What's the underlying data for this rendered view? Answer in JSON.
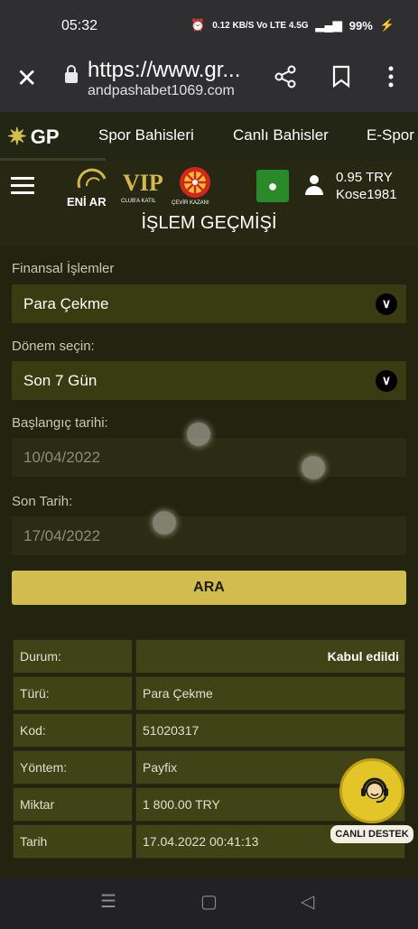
{
  "status_bar": {
    "time": "05:32",
    "indicators": "0.12 KB/S  Vo LTE  4.5G",
    "battery": "99%"
  },
  "url_bar": {
    "line1": "https://www.gr...",
    "line2": "andpashabet1069.com"
  },
  "top_nav": {
    "logo": "GP",
    "items": [
      "Spor Bahisleri",
      "Canlı Bahisler",
      "E-Spor"
    ]
  },
  "header": {
    "promo_eni": "ENİ AR",
    "promo_vip": "VIP",
    "promo_vip_sub": "CLUB'A KATIL",
    "promo_cevir_sub": "ÇEVİR KAZAN!",
    "balance": "0.95 TRY",
    "username": "Kose1981",
    "page_title": "İŞLEM GEÇMİŞİ"
  },
  "form": {
    "financial_label": "Finansal İşlemler",
    "financial_value": "Para Çekme",
    "period_label": "Dönem seçin:",
    "period_value": "Son 7 Gün",
    "start_label": "Başlangıç tarihi:",
    "start_value": "10/04/2022",
    "end_label": "Son Tarih:",
    "end_value": "17/04/2022",
    "search_button": "ARA"
  },
  "result": {
    "rows": [
      {
        "label": "Durum:",
        "value": "Kabul edildi"
      },
      {
        "label": "Türü:",
        "value": "Para Çekme"
      },
      {
        "label": "Kod:",
        "value": "51020317"
      },
      {
        "label": "Yöntem:",
        "value": "Payfix"
      },
      {
        "label": "Miktar",
        "value": "1 800.00 TRY"
      },
      {
        "label": "Tarih",
        "value": "17.04.2022 00:41:13"
      }
    ]
  },
  "live_support": {
    "label": "CANLI DESTEK"
  },
  "colors": {
    "accent": "#d1bd4f",
    "cell_bg": "#3f4315",
    "select_bg": "#393c10",
    "page_bg": "#1c1d10"
  }
}
